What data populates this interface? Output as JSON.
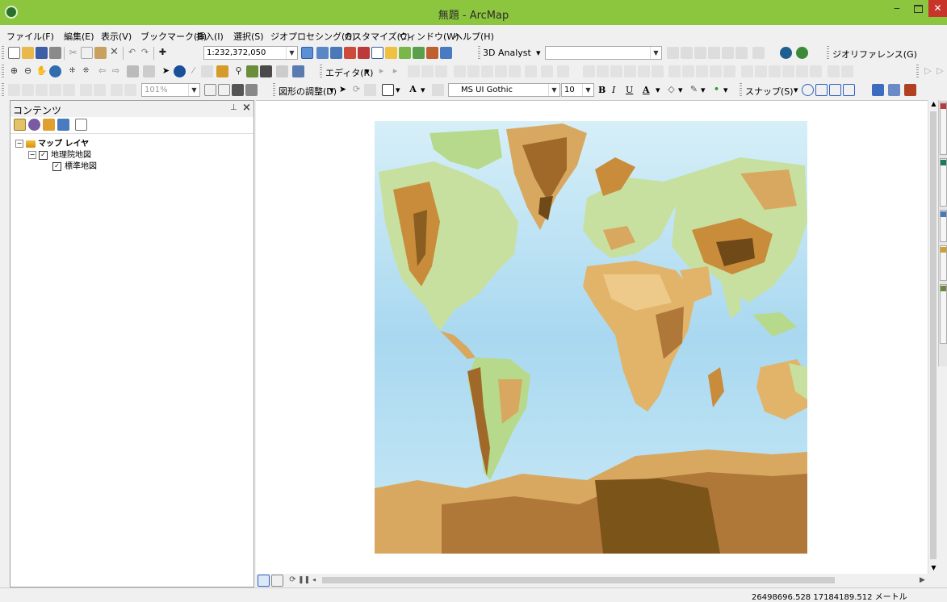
{
  "window": {
    "title": "無題 - ArcMap"
  },
  "menu": [
    "ファイル(F)",
    "編集(E)",
    "表示(V)",
    "ブックマーク(B)",
    "挿入(I)",
    "選択(S)",
    "ジオプロセシング(G)",
    "カスタマイズ(C)",
    "ウィンドウ(W)",
    "ヘルプ(H)"
  ],
  "toolbar1": {
    "scale_value": "1:232,372,050",
    "analyst_label": "3D Analyst",
    "georef_label": "ジオリファレンス(G)"
  },
  "toolbar2": {
    "editor_label": "エディタ(R)"
  },
  "toolbar3": {
    "zoom_percent": "101%",
    "drawing_label": "図形の調整(D)",
    "font_name": "MS UI Gothic",
    "font_size": "10",
    "bold_label": "B",
    "italic_label": "I",
    "underline_label": "U",
    "font_color_label": "A",
    "snap_label": "スナップ(S)"
  },
  "toc": {
    "title": "コンテンツ",
    "layers": [
      {
        "label": "マップ レイヤ",
        "checked": false
      },
      {
        "label": "地理院地図",
        "checked": true
      },
      {
        "label": "標準地図",
        "checked": true
      }
    ]
  },
  "map": {
    "layer_name": "標準地図",
    "projection": "World Mercator"
  },
  "status": {
    "coords": "26498696.528  17184189.512 メートル"
  },
  "colors": {
    "titlebar": "#8cc63f",
    "ocean_shallow": "#c9e9f6",
    "ocean_deep": "#8cc6e8",
    "lowland": "#b7d98b",
    "highland": "#c98c3b",
    "mountain": "#7a5418"
  }
}
